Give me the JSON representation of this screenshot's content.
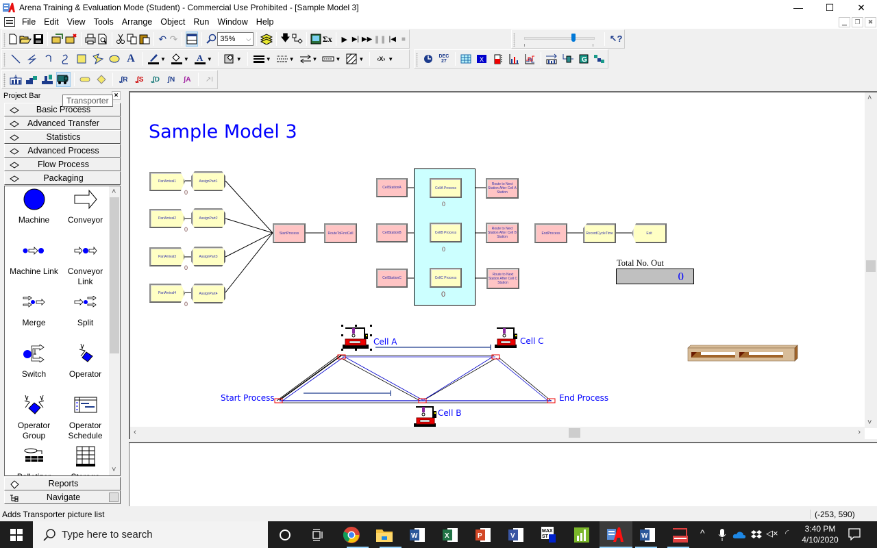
{
  "window": {
    "title": "Arena Training & Evaluation Mode (Student) - Commercial Use Prohibited - [Sample Model 3]",
    "controls": {
      "minimize": "—",
      "maximize": "☐",
      "close": "✕"
    },
    "mdi_controls": {
      "minimize": "▁",
      "restore": "❐",
      "close": "✖"
    }
  },
  "menu": [
    "File",
    "Edit",
    "View",
    "Tools",
    "Arrange",
    "Object",
    "Run",
    "Window",
    "Help"
  ],
  "toolbar": {
    "zoom_value": "35%",
    "standard_icons": [
      "new-icon",
      "open-icon",
      "save-icon",
      "open-template-icon",
      "detach-template-icon",
      "print-icon",
      "print-preview-icon",
      "cut-icon",
      "copy-icon",
      "paste-icon",
      "undo-icon",
      "redo-icon",
      "split-screen-icon",
      "zoom-icon",
      "layers-icon",
      "submodel-icon",
      "connect-icon",
      "animate-icon",
      "sigma-icon"
    ],
    "run_icons": [
      "go-icon",
      "step-icon",
      "fast-forward-icon",
      "pause-icon",
      "start-over-icon",
      "end-icon"
    ],
    "animation_speed": 0.7,
    "help_icon": "context-help-icon",
    "draw_icons": [
      "line-icon",
      "polyline-icon",
      "arc-icon",
      "bezier-icon",
      "box-icon",
      "polygon-icon",
      "ellipse-icon",
      "text-icon",
      "line-color-icon",
      "fill-color-icon",
      "text-color-icon",
      "window-background-icon",
      "line-width-icon",
      "line-style-icon",
      "arrow-style-icon",
      "line-pattern-icon",
      "fill-pattern-icon",
      "show-dimensions-icon"
    ],
    "animate_icons": [
      "clock-icon",
      "date-icon",
      "variable-icon",
      "level-icon",
      "histogram-icon",
      "plot-icon",
      "queue-icon",
      "resource-icon",
      "global-icon",
      "transporter-icon"
    ],
    "transfer_icons": [
      "station-icon",
      "intersection-icon",
      "route-icon",
      "segment-icon",
      "distance-icon",
      "network-icon",
      "promote-path-icon",
      "storage-icon",
      "seize-icon",
      "parking-icon",
      "transporter-icon",
      "stationmarker-icon",
      "intersection-marker-icon",
      "route-R-icon",
      "route-S-icon",
      "route-D-icon",
      "route-N-icon",
      "route-A-icon",
      "promote-icon"
    ],
    "tooltip": "Transporter"
  },
  "project_bar": {
    "title": "Project Bar",
    "close": "×",
    "panels_top": [
      "Basic Process",
      "Advanced Transfer",
      "Statistics",
      "Advanced Process",
      "Flow Process",
      "Packaging"
    ],
    "palette": [
      {
        "label": "Machine"
      },
      {
        "label": "Conveyor"
      },
      {
        "label": "Machine Link"
      },
      {
        "label": "Conveyor Link"
      },
      {
        "label": "Merge"
      },
      {
        "label": "Split"
      },
      {
        "label": "Switch"
      },
      {
        "label": "Operator"
      },
      {
        "label": "Operator Group"
      },
      {
        "label": "Operator Schedule"
      },
      {
        "label": "Palletizer"
      },
      {
        "label": "Storage"
      }
    ],
    "panels_bottom": [
      "Reports",
      "Navigate"
    ]
  },
  "model": {
    "title": "Sample Model 3",
    "arrivals": [
      "PartArrival1",
      "PartArrival2",
      "PartArrival3",
      "PartArrival4"
    ],
    "assigns": [
      "AssignPart1",
      "AssignPart2",
      "AssignPart3",
      "AssignPart4"
    ],
    "start_process": "StartProcess",
    "route_first": "RouteToFirstCell",
    "stations": [
      "CellStationA",
      "CellStationB",
      "CellStationC"
    ],
    "processes": [
      "CellA Process",
      "CellB Process",
      "CellC Process"
    ],
    "process_counters": [
      "0",
      "0",
      "0"
    ],
    "arrival_counters": [
      "0",
      "0",
      "0",
      "0"
    ],
    "routes_after": [
      "Route to Next Station After Cell A Station",
      "Route to Next Station After Cell B Station",
      "Route to Next Station After Cell C Station"
    ],
    "end_process": "EndProcess",
    "record": "RecordCycleTime",
    "exit": "Exit",
    "total_out_label": "Total No. Out",
    "total_out_value": "0"
  },
  "animation": {
    "labels": {
      "cell_a": "Cell A",
      "cell_b": "Cell B",
      "cell_c": "Cell C",
      "start": "Start Process",
      "end": "End Process"
    }
  },
  "statusbar": {
    "message": "Adds Transporter picture list",
    "coords": "(-253, 590)"
  },
  "taskbar": {
    "search_placeholder": "Type here to search",
    "time": "3:40 PM",
    "date": "4/10/2020",
    "apps": [
      "cortana-icon",
      "task-view-icon",
      "chrome-icon",
      "file-explorer-icon",
      "word-icon",
      "excel-icon",
      "powerpoint-icon",
      "visio-icon",
      "maxst-icon",
      "minitab-icon",
      "arena-icon",
      "word-icon-2",
      "factory-icon"
    ]
  },
  "colors": {
    "accent": "#0000ff",
    "block_yellow": "#ffffc4",
    "block_pink": "#ffc4c4",
    "submodel_cyan": "#ccffff",
    "taskbar": "#1e1e1e"
  }
}
